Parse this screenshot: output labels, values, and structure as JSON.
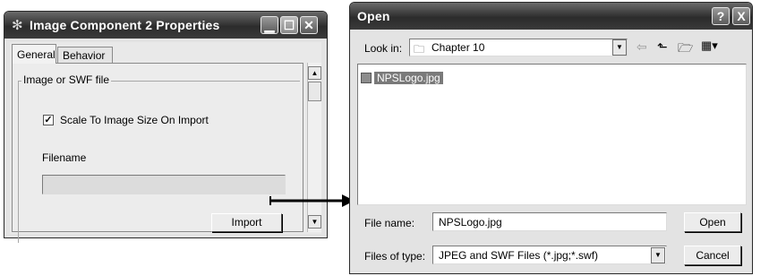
{
  "left_window": {
    "title": "Image Component 2 Properties",
    "tabs": [
      "General",
      "Behavior"
    ],
    "group_label": "Image or SWF file",
    "checkbox_label": "Scale To Image Size On Import",
    "checkbox_checked": true,
    "filename_label": "Filename",
    "filename_value": "",
    "import_button": "Import"
  },
  "right_window": {
    "title": "Open",
    "look_in_label": "Look in:",
    "look_in_value": "Chapter 10",
    "files": [
      "NPSLogo.jpg"
    ],
    "file_name_label": "File name:",
    "file_name_value": "NPSLogo.jpg",
    "files_of_type_label": "Files of type:",
    "files_of_type_value": "JPEG and SWF Files (*.jpg;*.swf)",
    "open_button": "Open",
    "cancel_button": "Cancel",
    "help_button": "?",
    "close_button": "X"
  },
  "icons": [
    "gear-icon",
    "minimize-icon",
    "maximize-icon",
    "close-icon",
    "folder-icon",
    "back-arrow-icon",
    "up-folder-icon",
    "new-folder-icon",
    "view-menu-icon",
    "image-file-icon",
    "arrow-connector"
  ]
}
